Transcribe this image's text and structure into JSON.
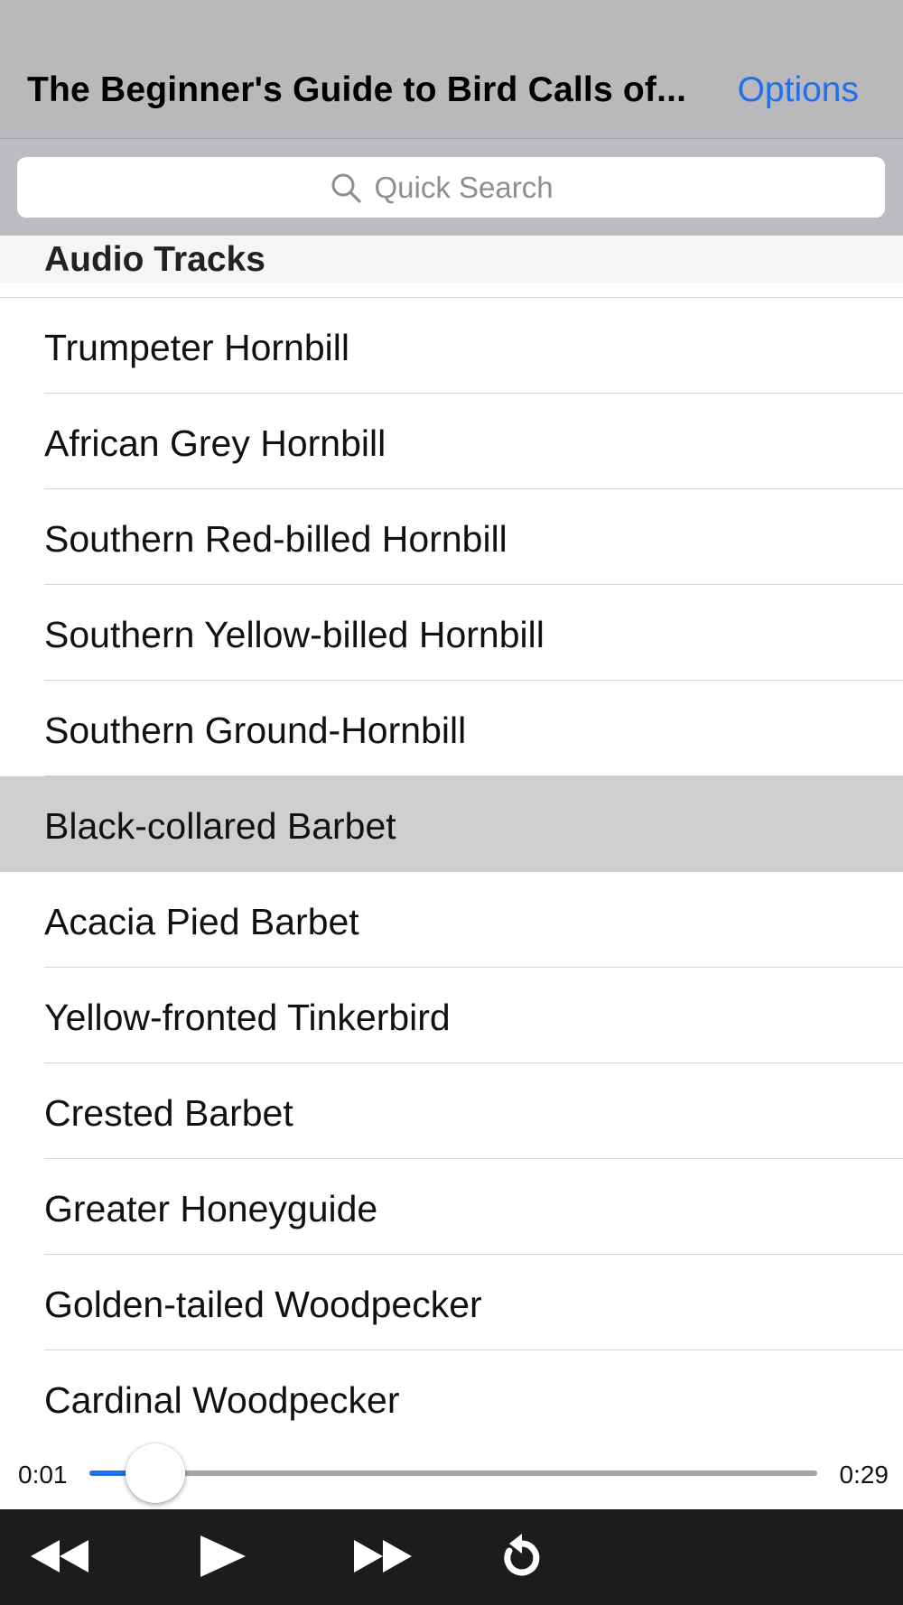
{
  "header": {
    "title": "The Beginner's Guide to Bird Calls of...",
    "options_label": "Options"
  },
  "search": {
    "placeholder": "Quick Search",
    "icon": "magnifier-icon"
  },
  "section": {
    "title": "Audio Tracks"
  },
  "tracks": [
    {
      "label": "Trumpeter Hornbill"
    },
    {
      "label": "African Grey Hornbill"
    },
    {
      "label": "Southern Red-billed Hornbill"
    },
    {
      "label": "Southern Yellow-billed Hornbill"
    },
    {
      "label": "Southern Ground-Hornbill"
    },
    {
      "label": "Black-collared Barbet",
      "selected": true
    },
    {
      "label": "Acacia Pied Barbet"
    },
    {
      "label": "Yellow-fronted Tinkerbird"
    },
    {
      "label": "Crested Barbet"
    },
    {
      "label": "Greater Honeyguide"
    },
    {
      "label": "Golden-tailed Woodpecker"
    },
    {
      "label": "Cardinal Woodpecker"
    }
  ],
  "player": {
    "current_time": "0:01",
    "total_time": "0:29",
    "progress": 0.09
  },
  "controls": {
    "icons": [
      "rewind-icon",
      "play-icon",
      "fast-forward-icon",
      "repeat-icon"
    ]
  },
  "colors": {
    "accent": "#1f6fef",
    "navbar": "#b9b9bb",
    "selected_row": "#cfcfcf",
    "toolbar": "#1c1c1e"
  }
}
